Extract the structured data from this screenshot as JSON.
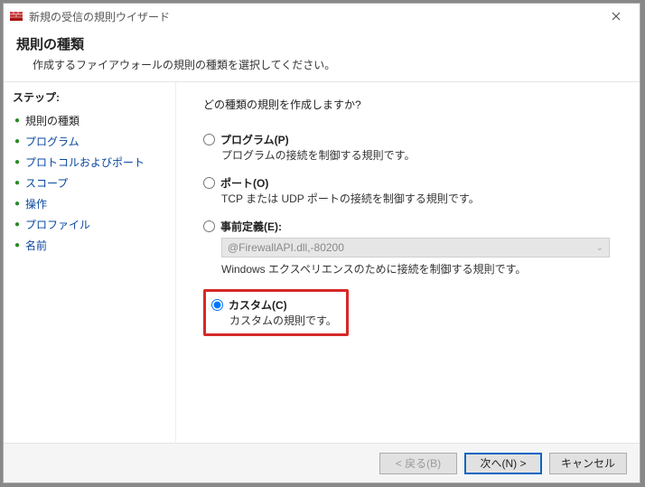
{
  "window": {
    "title": "新規の受信の規則ウイザード"
  },
  "header": {
    "title": "規則の種類",
    "subtitle": "作成するファイアウォールの規則の種類を選択してください。"
  },
  "sidebar": {
    "title": "ステップ:",
    "steps": [
      {
        "label": "規則の種類",
        "current": true
      },
      {
        "label": "プログラム",
        "current": false
      },
      {
        "label": "プロトコルおよびポート",
        "current": false
      },
      {
        "label": "スコープ",
        "current": false
      },
      {
        "label": "操作",
        "current": false
      },
      {
        "label": "プロファイル",
        "current": false
      },
      {
        "label": "名前",
        "current": false
      }
    ]
  },
  "content": {
    "prompt": "どの種類の規則を作成しますか?",
    "options": {
      "program": {
        "label": "プログラム(P)",
        "desc": "プログラムの接続を制御する規則です。"
      },
      "port": {
        "label": "ポート(O)",
        "desc": "TCP または UDP ポートの接続を制御する規則です。"
      },
      "predef": {
        "label": "事前定義(E):",
        "dropdown": "@FirewallAPI.dll,-80200",
        "desc": "Windows エクスペリエンスのために接続を制御する規則です。"
      },
      "custom": {
        "label": "カスタム(C)",
        "desc": "カスタムの規則です。"
      }
    },
    "selected": "custom"
  },
  "footer": {
    "back": "< 戻る(B)",
    "next": "次へ(N) >",
    "cancel": "キャンセル"
  }
}
